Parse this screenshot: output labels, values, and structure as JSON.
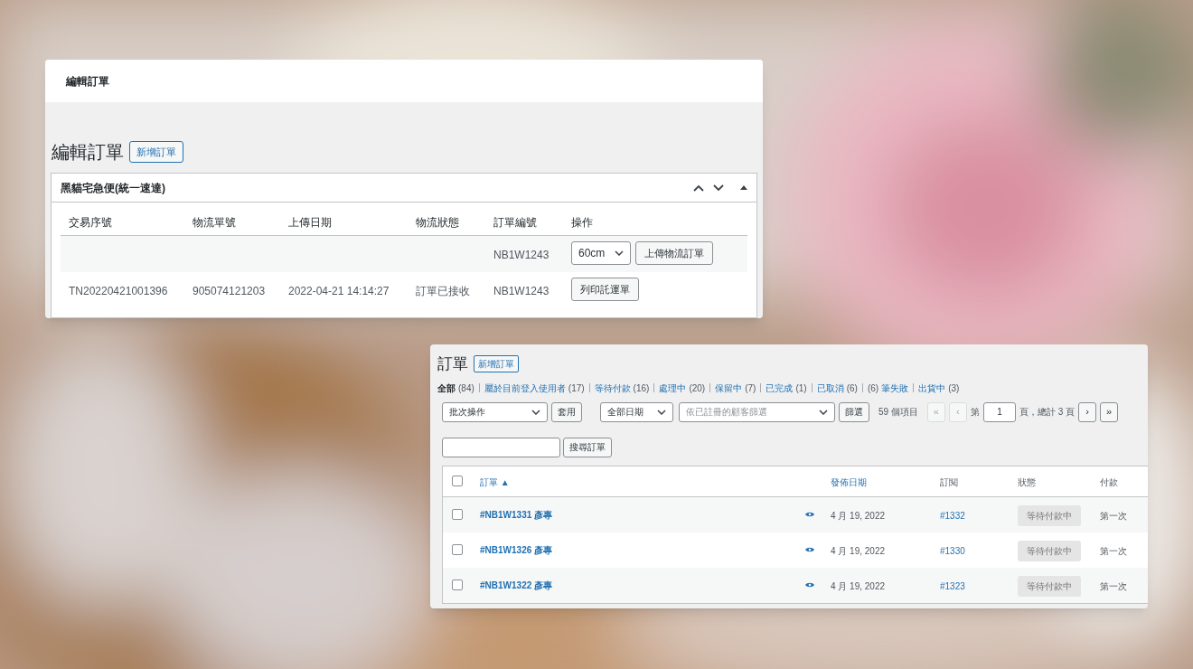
{
  "edit_panel": {
    "top_title": "編輯訂單",
    "heading": "編輯訂單",
    "add_button": "新增訂單",
    "box": {
      "title": "黑貓宅急便(統一速達)",
      "columns": [
        "交易序號",
        "物流單號",
        "上傳日期",
        "物流狀態",
        "訂單編號",
        "操作"
      ],
      "rows": [
        {
          "cells": [
            "",
            "",
            "",
            "",
            "NB1W1243"
          ],
          "actions": [
            {
              "kind": "select",
              "value": "60cm"
            },
            {
              "kind": "button",
              "label": "上傳物流訂單"
            }
          ]
        },
        {
          "cells": [
            "TN20220421001396",
            "905074121203",
            "2022-04-21 14:14:27",
            "訂單已接收",
            "NB1W1243"
          ],
          "actions": [
            {
              "kind": "button",
              "label": "列印託運單"
            }
          ]
        }
      ]
    }
  },
  "orders_panel": {
    "heading": "訂單",
    "add_button": "新增訂單",
    "filters": [
      {
        "label": "全部",
        "count": "(84)",
        "selected": true,
        "count_first": false
      },
      {
        "label": "屬於目前登入使用者",
        "count": "(17)",
        "selected": false,
        "count_first": false
      },
      {
        "label": "等待付款",
        "count": "(16)",
        "selected": false,
        "count_first": false
      },
      {
        "label": "處理中",
        "count": "(20)",
        "selected": false,
        "count_first": false
      },
      {
        "label": "保留中",
        "count": "(7)",
        "selected": false,
        "count_first": false
      },
      {
        "label": "已完成",
        "count": "(1)",
        "selected": false,
        "count_first": false
      },
      {
        "label": "已取消",
        "count": "(6)",
        "selected": false,
        "count_first": false
      },
      {
        "label": "筆失敗",
        "count": "(6)",
        "selected": false,
        "count_first": true
      },
      {
        "label": "出貨中",
        "count": "(3)",
        "selected": false,
        "count_first": false
      }
    ],
    "bulk_select": "批次操作",
    "apply_button": "套用",
    "date_select": "全部日期",
    "customer_placeholder": "依已註冊的顧客篩選",
    "filter_button": "篩選",
    "item_count": "59 個項目",
    "pager": {
      "first": {
        "label": "«",
        "disabled": true
      },
      "prev": {
        "label": "‹",
        "disabled": true
      },
      "page_prefix": "第",
      "page": "1",
      "page_suffix": "頁，總計 3 頁",
      "next": {
        "label": "›",
        "disabled": false
      },
      "last": {
        "label": "»",
        "disabled": false
      }
    },
    "search_button": "搜尋訂單",
    "select_all_checked": false,
    "columns": [
      {
        "label": "訂單",
        "sortable": true,
        "sort_mark": "▲"
      },
      {
        "label": "發佈日期",
        "sortable": true
      },
      {
        "label": "訂閱",
        "sortable": false
      },
      {
        "label": "狀態",
        "sortable": false
      },
      {
        "label": "付款",
        "sortable": false
      }
    ],
    "rows": [
      {
        "checked": false,
        "order": "#NB1W1331 彥專",
        "date": "4 月 19, 2022",
        "subscription": "#1332",
        "status": "等待付款中",
        "payment": "第一次"
      },
      {
        "checked": false,
        "order": "#NB1W1326 彥專",
        "date": "4 月 19, 2022",
        "subscription": "#1330",
        "status": "等待付款中",
        "payment": "第一次"
      },
      {
        "checked": false,
        "order": "#NB1W1322 彥專",
        "date": "4 月 19, 2022",
        "subscription": "#1323",
        "status": "等待付款中",
        "payment": "第一次"
      }
    ]
  }
}
